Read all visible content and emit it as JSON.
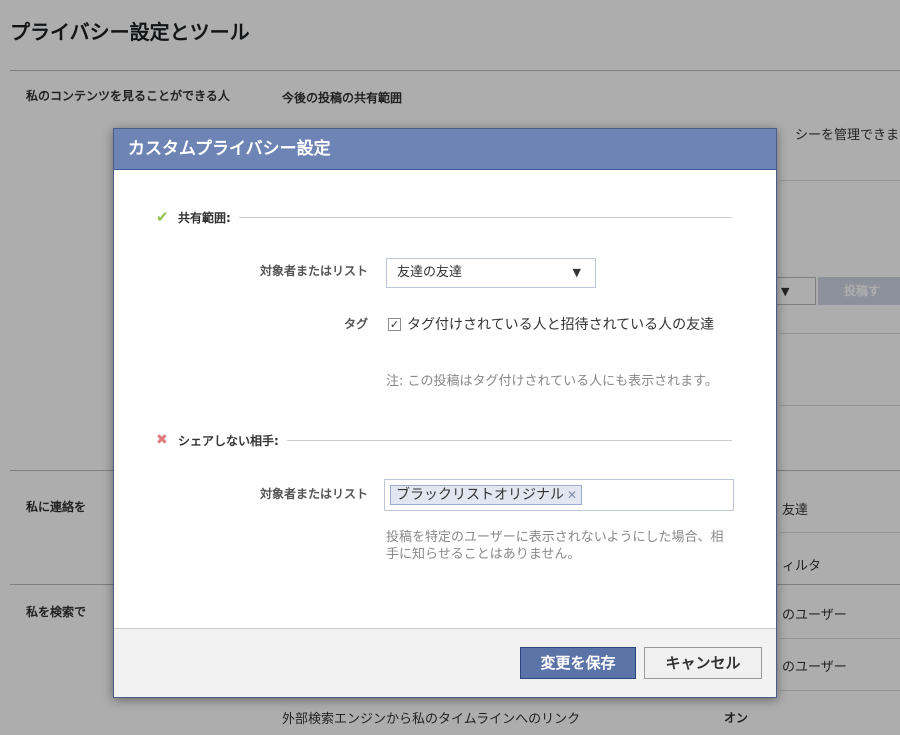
{
  "page": {
    "title": "プライバシー設定とツール",
    "sections": [
      {
        "label": "私のコンテンツを見ることができる人"
      },
      {
        "label": "私に連絡を"
      },
      {
        "label": "私を検索で"
      }
    ],
    "background_texts": {
      "future_posts": "今後の投稿の共有範囲",
      "manage_fragment": "シーを管理できま",
      "post_button": "投稿す",
      "friends": "友達",
      "filter": "ィルタ",
      "users_1": "のユーザー",
      "users_2": "のユーザー",
      "external_search": "外部検索エンジンから私のタイムラインへのリンク",
      "on": "オン"
    }
  },
  "dialog": {
    "title": "カスタムプライバシー設定",
    "share": {
      "heading": "共有範囲:",
      "audience_label": "対象者またはリスト",
      "audience_value": "友達の友達",
      "tag_label": "タグ",
      "tag_checkbox_checked": true,
      "tag_text": "タグ付けされている人と招待されている人の友達",
      "tag_note": "注: この投稿はタグ付けされている人にも表示されます。"
    },
    "exclude": {
      "heading": "シェアしない相手:",
      "audience_label": "対象者またはリスト",
      "token": "ブラックリストオリジナル",
      "note": "投稿を特定のユーザーに表示されないようにした場合、相手に知らせることはありません。"
    },
    "buttons": {
      "save": "変更を保存",
      "cancel": "キャンセル"
    }
  },
  "icons": {
    "check": "check-icon",
    "cross": "cross-icon",
    "dropdown": "triangle-down-icon",
    "remove": "remove-x-icon"
  },
  "colors": {
    "header": "#6d84b4",
    "primary_button": "#5b74a8",
    "check": "#8cc152",
    "cross": "#e07a7a"
  }
}
